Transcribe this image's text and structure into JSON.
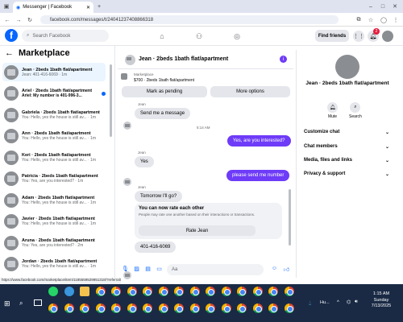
{
  "browser": {
    "tab_title": "Messenger | Facebook",
    "url": "facebook.com/messages/t/24041237408866318",
    "status_url": "https://www.facebook.com/marketplace/item/1185559529951318/?referralS..."
  },
  "header": {
    "search_placeholder": "Search Facebook",
    "find_friends": "Find friends",
    "notification_count": "2"
  },
  "marketplace": {
    "title": "Marketplace",
    "conversations": [
      {
        "name": "Jean · 2beds 1bath flat/apartment",
        "preview": "Jean: 401-416-6069 · 1m",
        "active": true,
        "unread": false
      },
      {
        "name": "Ariel · 2beds 1bath flat/apartment",
        "preview": "Ariel: My number is 401-996-3...",
        "active": false,
        "unread": true
      },
      {
        "name": "Gabriela · 2beds 1bath flat/apartment",
        "preview": "You: Hello, yes the house is still av... · 1m",
        "active": false,
        "unread": false
      },
      {
        "name": "Ann · 2beds 1bath flat/apartment",
        "preview": "You: Hello, yes the house is still av... · 1m",
        "active": false,
        "unread": false
      },
      {
        "name": "Keri · 2beds 1bath flat/apartment",
        "preview": "You: Hello, yes the house is still av... · 1m",
        "active": false,
        "unread": false
      },
      {
        "name": "Patricia · 2beds 1bath flat/apartment",
        "preview": "You: Yes, are you interested? · 1m",
        "active": false,
        "unread": false
      },
      {
        "name": "Adam · 2beds 1bath flat/apartment",
        "preview": "You: Hello, yes the house is still av... · 1m",
        "active": false,
        "unread": false
      },
      {
        "name": "Javier · 2beds 1bath flat/apartment",
        "preview": "You: Hello, yes the house is still av... · 1m",
        "active": false,
        "unread": false
      },
      {
        "name": "Aruna · 2beds 1bath flat/apartment",
        "preview": "You: Yes, are you interested? · 2m",
        "active": false,
        "unread": false
      },
      {
        "name": "Jordan · 2beds 1bath flat/apartment",
        "preview": "You: Hello, yes the house is still av... · 1m",
        "active": false,
        "unread": false
      }
    ]
  },
  "chat": {
    "title": "Jean · 2beds 1bath flat/apartment",
    "listing_label": "Marketplace",
    "listing_price": "$700 · 2beds 1bath flat/apartment",
    "mark_pending": "Mark as pending",
    "more_options": "More options",
    "sender": "Jean",
    "msg1": "Send me a message",
    "time": "5:14 AM",
    "out1": "Yes, are you interested?",
    "msg2": "Yes",
    "out2": "please send me number",
    "msg3": "Tomorrow I'll go?",
    "rate_title": "You can now rate each other",
    "rate_desc": "People may rate one another based on their interactions or transactions.",
    "rate_button": "Rate Jean",
    "msg4": "401-416-6069",
    "composer_placeholder": "Aa"
  },
  "details": {
    "title": "Jean · 2beds 1bath flat/apartment",
    "mute": "Mute",
    "search": "Search",
    "sections": [
      "Customize chat",
      "Chat members",
      "Media, files and links",
      "Privacy & support"
    ]
  },
  "taskbar": {
    "weather": "Hu...",
    "time": "1:15 AM",
    "day": "Sunday",
    "date": "7/13/2025"
  }
}
